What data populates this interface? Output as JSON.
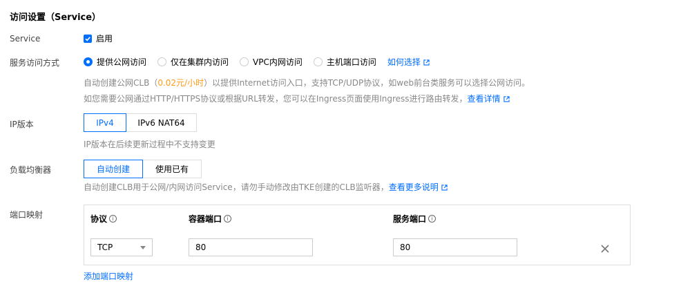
{
  "section_title": "访问设置（Service）",
  "service": {
    "label": "Service",
    "checkbox_label": "启用",
    "checked": true
  },
  "access_mode": {
    "label": "服务访问方式",
    "options": [
      "提供公网访问",
      "仅在集群内访问",
      "VPC内网访问",
      "主机端口访问"
    ],
    "selected_index": 0,
    "help_link": "如何选择",
    "desc1_prefix": "自动创建公网CLB（",
    "desc1_price": "0.02元/小时",
    "desc1_suffix": "）以提供Internet访问入口，支持TCP/UDP协议，如web前台类服务可以选择公网访问。",
    "desc2": "如您需要公网通过HTTP/HTTPS协议或根据URL转发，您可以在Ingress页面使用Ingress进行路由转发，",
    "desc2_link": "查看详情"
  },
  "ip_version": {
    "label": "IP版本",
    "options": [
      "IPv4",
      "IPv6 NAT64"
    ],
    "selected_index": 0,
    "note": "IP版本在后续更新过程中不支持变更"
  },
  "load_balancer": {
    "label": "负载均衡器",
    "options": [
      "自动创建",
      "使用已有"
    ],
    "selected_index": 0,
    "note": "自动创建CLB用于公网/内网访问Service，请勿手动修改由TKE创建的CLB监听器，",
    "note_link": "查看更多说明"
  },
  "port_mapping": {
    "label": "端口映射",
    "headers": {
      "protocol": "协议",
      "container_port": "容器端口",
      "service_port": "服务端口"
    },
    "rows": [
      {
        "protocol": "TCP",
        "container_port": "80",
        "service_port": "80"
      }
    ],
    "add_link": "添加端口映射"
  },
  "icons": {
    "info": "info-icon",
    "external": "external-link-icon",
    "close": "close-icon"
  },
  "colors": {
    "accent": "#006eff",
    "price": "#ff9c19",
    "muted": "#888888"
  }
}
